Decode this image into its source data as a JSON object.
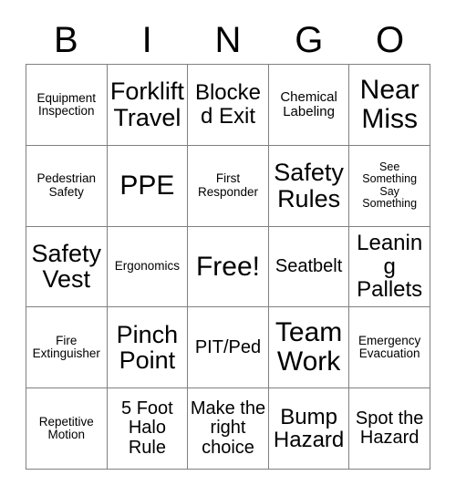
{
  "card": {
    "title_letters": [
      "B",
      "I",
      "N",
      "G",
      "O"
    ],
    "free_space_label": "Free!",
    "colors": {
      "background": "#ffffff",
      "text": "#000000",
      "grid_line": "#808080"
    }
  },
  "grid": {
    "columns": 5,
    "rows": 5,
    "cells": [
      [
        {
          "text": "Equipment Inspection",
          "size": "xs"
        },
        {
          "text": "Forklift Travel",
          "size": "xl"
        },
        {
          "text": "Blocked Exit",
          "size": "lg"
        },
        {
          "text": "Chemical Labeling",
          "size": "sm"
        },
        {
          "text": "Near Miss",
          "size": "xxl"
        }
      ],
      [
        {
          "text": "Pedestrian Safety",
          "size": "xs"
        },
        {
          "text": "PPE",
          "size": "xxl"
        },
        {
          "text": "First Responder",
          "size": "xs"
        },
        {
          "text": "Safety Rules",
          "size": "xl"
        },
        {
          "text": "See Something Say Something",
          "size": "xxs"
        }
      ],
      [
        {
          "text": "Safety Vest",
          "size": "xl"
        },
        {
          "text": "Ergonomics",
          "size": "xs"
        },
        {
          "text": "Free!",
          "size": "xxl"
        },
        {
          "text": "Seatbelt",
          "size": "md"
        },
        {
          "text": "Leaning Pallets",
          "size": "lg"
        }
      ],
      [
        {
          "text": "Fire Extinguisher",
          "size": "xs"
        },
        {
          "text": "Pinch Point",
          "size": "xl"
        },
        {
          "text": "PIT/Ped",
          "size": "md"
        },
        {
          "text": "Team Work",
          "size": "xxl"
        },
        {
          "text": "Emergency Evacuation",
          "size": "xs"
        }
      ],
      [
        {
          "text": "Repetitive Motion",
          "size": "xs"
        },
        {
          "text": "5 Foot Halo Rule",
          "size": "md"
        },
        {
          "text": "Make the right choice",
          "size": "md"
        },
        {
          "text": "Bump Hazard",
          "size": "lg"
        },
        {
          "text": "Spot the Hazard",
          "size": "md"
        }
      ]
    ]
  }
}
